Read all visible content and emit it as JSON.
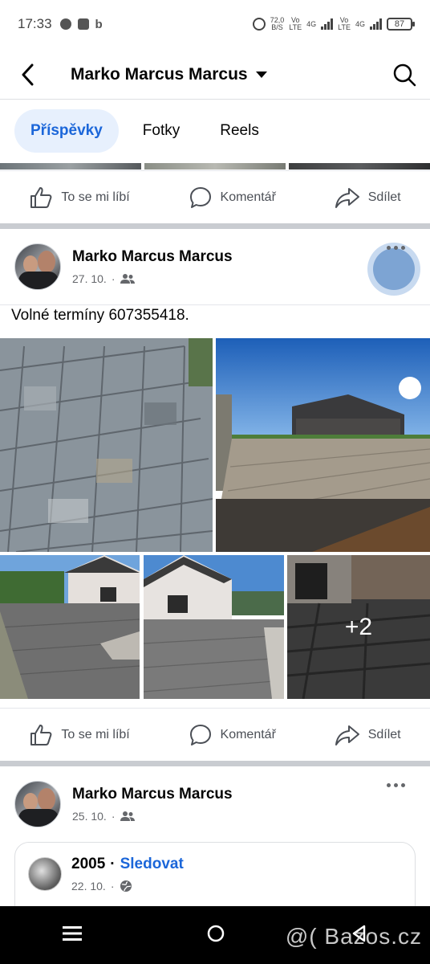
{
  "status_bar": {
    "time": "17:33",
    "speed_value": "72,0",
    "speed_unit": "B/S",
    "net1_top": "Vo",
    "net1_bottom": "LTE",
    "net1_gen": "4G",
    "net2_top": "Vo",
    "net2_bottom": "LTE",
    "net2_gen": "4G",
    "battery": "87"
  },
  "header": {
    "title": "Marko Marcus Marcus"
  },
  "tabs": [
    {
      "label": "Příspěvky",
      "active": true
    },
    {
      "label": "Fotky",
      "active": false
    },
    {
      "label": "Reels",
      "active": false
    }
  ],
  "actions": {
    "like": "To se mi líbí",
    "comment": "Komentář",
    "share": "Sdílet"
  },
  "posts": [
    {
      "author": "Marko Marcus Marcus",
      "date": "27. 10.",
      "audience_icon": "friends-icon",
      "text": "Volné termíny 607355418.",
      "more_photos": "+2"
    },
    {
      "author": "Marko Marcus Marcus",
      "date": "25. 10.",
      "audience_icon": "friends-icon",
      "shared": {
        "name": "2005",
        "separator": "·",
        "follow": "Sledovat",
        "date": "22. 10.",
        "audience_icon": "globe-icon"
      }
    }
  ],
  "watermark": "@( Bazos.cz",
  "colors": {
    "accent": "#1b66d9",
    "active_tab_bg": "#e7f0fd",
    "divider": "#c9ccd1"
  }
}
